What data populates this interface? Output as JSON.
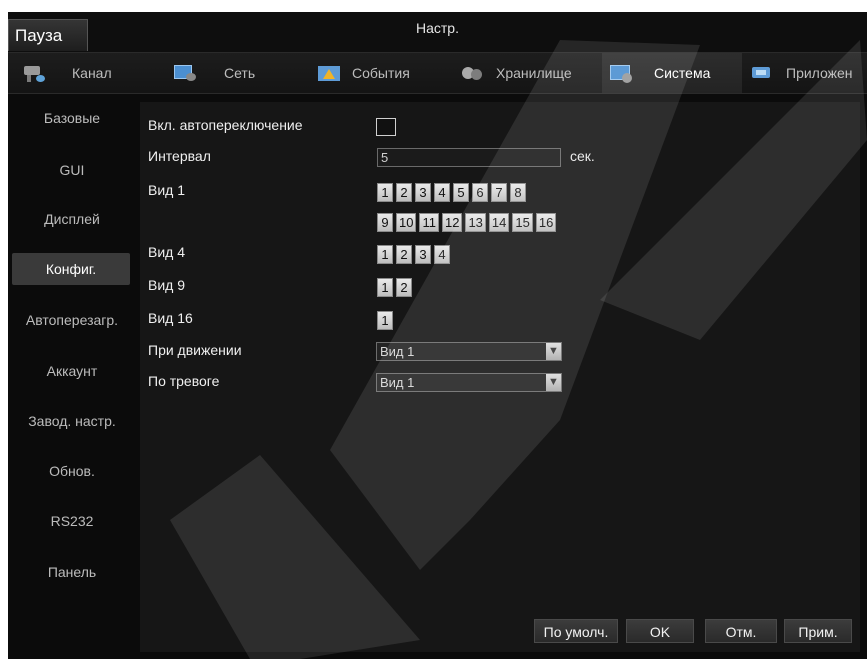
{
  "header": {
    "pause_label": "Пауза",
    "title": "Настр."
  },
  "tabs": [
    {
      "label": "Канал",
      "icon": "camera-icon"
    },
    {
      "label": "Сеть",
      "icon": "network-icon"
    },
    {
      "label": "События",
      "icon": "alarm-icon"
    },
    {
      "label": "Хранилище",
      "icon": "storage-icon"
    },
    {
      "label": "Система",
      "icon": "system-icon"
    },
    {
      "label": "Приложен",
      "icon": "apps-icon"
    }
  ],
  "sidebar": {
    "items": [
      {
        "label": "Базовые"
      },
      {
        "label": "GUI"
      },
      {
        "label": "Дисплей"
      },
      {
        "label": "Конфиг."
      },
      {
        "label": "Автоперезагр."
      },
      {
        "label": "Аккаунт"
      },
      {
        "label": "Завод. настр."
      },
      {
        "label": "Обнов."
      },
      {
        "label": "RS232"
      },
      {
        "label": "Панель"
      }
    ],
    "active": "Конфиг."
  },
  "form": {
    "auto_switch_label": "Вкл. автопереключение",
    "interval_label": "Интервал",
    "interval_value": "5",
    "interval_unit": "сек.",
    "view1_label": "Вид 1",
    "view1_row1": [
      "1",
      "2",
      "3",
      "4",
      "5",
      "6",
      "7",
      "8"
    ],
    "view1_row2": [
      "9",
      "10",
      "11",
      "12",
      "13",
      "14",
      "15",
      "16"
    ],
    "view4_label": "Вид 4",
    "view4": [
      "1",
      "2",
      "3",
      "4"
    ],
    "view9_label": "Вид 9",
    "view9": [
      "1",
      "2"
    ],
    "view16_label": "Вид 16",
    "view16": [
      "1"
    ],
    "motion_label": "При движении",
    "motion_value": "Вид 1",
    "alarm_label": "По тревоге",
    "alarm_value": "Вид 1"
  },
  "footer": {
    "default_label": "По умолч.",
    "ok_label": "OK",
    "cancel_label": "Отм.",
    "apply_label": "Прим."
  }
}
